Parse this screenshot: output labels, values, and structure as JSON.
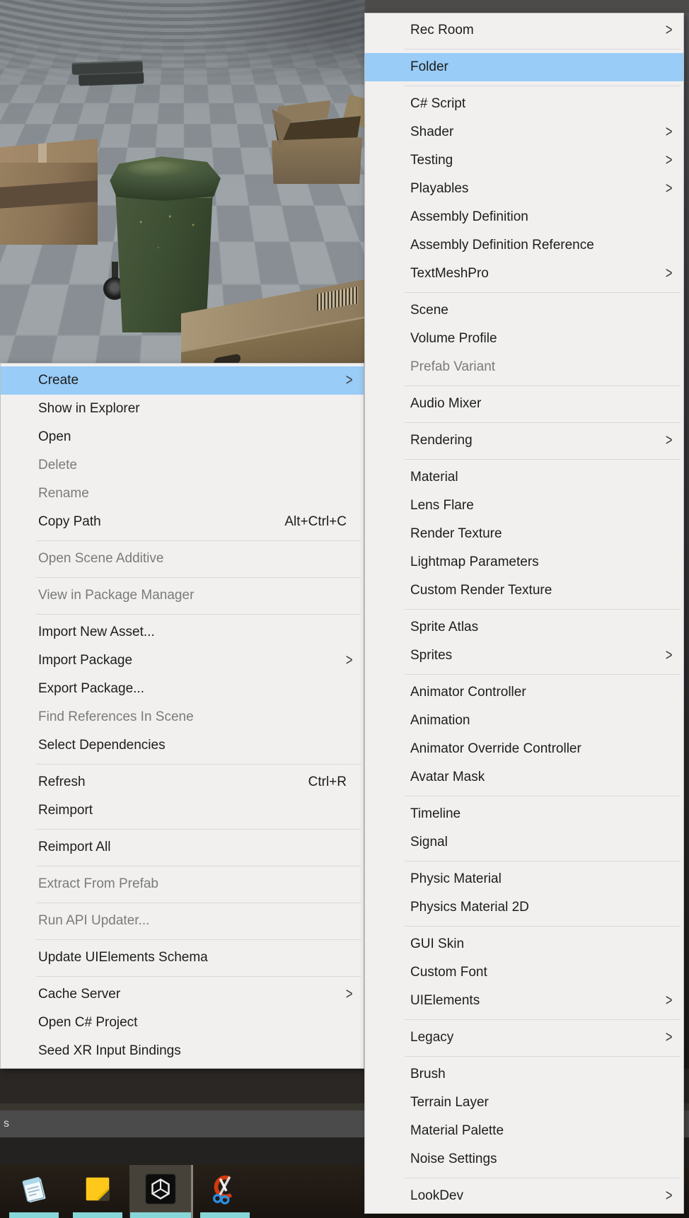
{
  "scene": {
    "objects": [
      {
        "name": "dark-pallet"
      },
      {
        "name": "closed-cardboard-box"
      },
      {
        "name": "green-wheelie-bin"
      },
      {
        "name": "open-cardboard-box"
      },
      {
        "name": "long-cardboard-box"
      }
    ]
  },
  "left_menu": {
    "items": [
      {
        "type": "item",
        "label": "Create",
        "highlighted": true,
        "submenu": true
      },
      {
        "type": "item",
        "label": "Show in Explorer"
      },
      {
        "type": "item",
        "label": "Open"
      },
      {
        "type": "item",
        "label": "Delete",
        "disabled": true
      },
      {
        "type": "item",
        "label": "Rename",
        "disabled": true
      },
      {
        "type": "item",
        "label": "Copy Path",
        "shortcut": "Alt+Ctrl+C"
      },
      {
        "type": "separator"
      },
      {
        "type": "item",
        "label": "Open Scene Additive",
        "disabled": true
      },
      {
        "type": "separator"
      },
      {
        "type": "item",
        "label": "View in Package Manager",
        "disabled": true
      },
      {
        "type": "separator"
      },
      {
        "type": "item",
        "label": "Import New Asset..."
      },
      {
        "type": "item",
        "label": "Import Package",
        "submenu": true
      },
      {
        "type": "item",
        "label": "Export Package..."
      },
      {
        "type": "item",
        "label": "Find References In Scene",
        "disabled": true
      },
      {
        "type": "item",
        "label": "Select Dependencies"
      },
      {
        "type": "separator"
      },
      {
        "type": "item",
        "label": "Refresh",
        "shortcut": "Ctrl+R"
      },
      {
        "type": "item",
        "label": "Reimport"
      },
      {
        "type": "separator"
      },
      {
        "type": "item",
        "label": "Reimport All"
      },
      {
        "type": "separator"
      },
      {
        "type": "item",
        "label": "Extract From Prefab",
        "disabled": true
      },
      {
        "type": "separator"
      },
      {
        "type": "item",
        "label": "Run API Updater...",
        "disabled": true
      },
      {
        "type": "separator"
      },
      {
        "type": "item",
        "label": "Update UIElements Schema"
      },
      {
        "type": "separator"
      },
      {
        "type": "item",
        "label": "Cache Server",
        "submenu": true
      },
      {
        "type": "item",
        "label": "Open C# Project"
      },
      {
        "type": "item",
        "label": "Seed XR Input Bindings"
      }
    ]
  },
  "right_menu": {
    "items": [
      {
        "type": "item",
        "label": "Rec Room",
        "submenu": true
      },
      {
        "type": "separator"
      },
      {
        "type": "item",
        "label": "Folder",
        "highlighted": true
      },
      {
        "type": "separator"
      },
      {
        "type": "item",
        "label": "C# Script"
      },
      {
        "type": "item",
        "label": "Shader",
        "submenu": true
      },
      {
        "type": "item",
        "label": "Testing",
        "submenu": true
      },
      {
        "type": "item",
        "label": "Playables",
        "submenu": true
      },
      {
        "type": "item",
        "label": "Assembly Definition"
      },
      {
        "type": "item",
        "label": "Assembly Definition Reference"
      },
      {
        "type": "item",
        "label": "TextMeshPro",
        "submenu": true
      },
      {
        "type": "separator"
      },
      {
        "type": "item",
        "label": "Scene"
      },
      {
        "type": "item",
        "label": "Volume Profile"
      },
      {
        "type": "item",
        "label": "Prefab Variant",
        "disabled": true
      },
      {
        "type": "separator"
      },
      {
        "type": "item",
        "label": "Audio Mixer"
      },
      {
        "type": "separator"
      },
      {
        "type": "item",
        "label": "Rendering",
        "submenu": true
      },
      {
        "type": "separator"
      },
      {
        "type": "item",
        "label": "Material"
      },
      {
        "type": "item",
        "label": "Lens Flare"
      },
      {
        "type": "item",
        "label": "Render Texture"
      },
      {
        "type": "item",
        "label": "Lightmap Parameters"
      },
      {
        "type": "item",
        "label": "Custom Render Texture"
      },
      {
        "type": "separator"
      },
      {
        "type": "item",
        "label": "Sprite Atlas"
      },
      {
        "type": "item",
        "label": "Sprites",
        "submenu": true
      },
      {
        "type": "separator"
      },
      {
        "type": "item",
        "label": "Animator Controller"
      },
      {
        "type": "item",
        "label": "Animation"
      },
      {
        "type": "item",
        "label": "Animator Override Controller"
      },
      {
        "type": "item",
        "label": "Avatar Mask"
      },
      {
        "type": "separator"
      },
      {
        "type": "item",
        "label": "Timeline"
      },
      {
        "type": "item",
        "label": "Signal"
      },
      {
        "type": "separator"
      },
      {
        "type": "item",
        "label": "Physic Material"
      },
      {
        "type": "item",
        "label": "Physics Material 2D"
      },
      {
        "type": "separator"
      },
      {
        "type": "item",
        "label": "GUI Skin"
      },
      {
        "type": "item",
        "label": "Custom Font"
      },
      {
        "type": "item",
        "label": "UIElements",
        "submenu": true
      },
      {
        "type": "separator"
      },
      {
        "type": "item",
        "label": "Legacy",
        "submenu": true
      },
      {
        "type": "separator"
      },
      {
        "type": "item",
        "label": "Brush"
      },
      {
        "type": "item",
        "label": "Terrain Layer"
      },
      {
        "type": "item",
        "label": "Material Palette"
      },
      {
        "type": "item",
        "label": "Noise Settings"
      },
      {
        "type": "separator"
      },
      {
        "type": "item",
        "label": "LookDev",
        "submenu": true
      }
    ]
  },
  "status_bar": {
    "text": "s"
  },
  "taskbar": {
    "buttons": [
      {
        "icon": "notepad-icon",
        "active": false
      },
      {
        "icon": "sticky-notes-icon",
        "active": false
      },
      {
        "icon": "unity-icon",
        "active": true
      },
      {
        "icon": "snipping-tool-icon",
        "active": false
      }
    ]
  },
  "colors": {
    "menu_background": "#f1f0ef",
    "menu_highlight": "#99ccf7",
    "menu_text": "#1d1d1d",
    "menu_disabled_text": "#7b7b7b",
    "menu_separator": "#d9d9d9",
    "status_strip": "#4b4b4b",
    "taskbar_indicator": "#87d6d8",
    "floor_light": "#9ea4a8",
    "floor_dark": "#888e93"
  }
}
